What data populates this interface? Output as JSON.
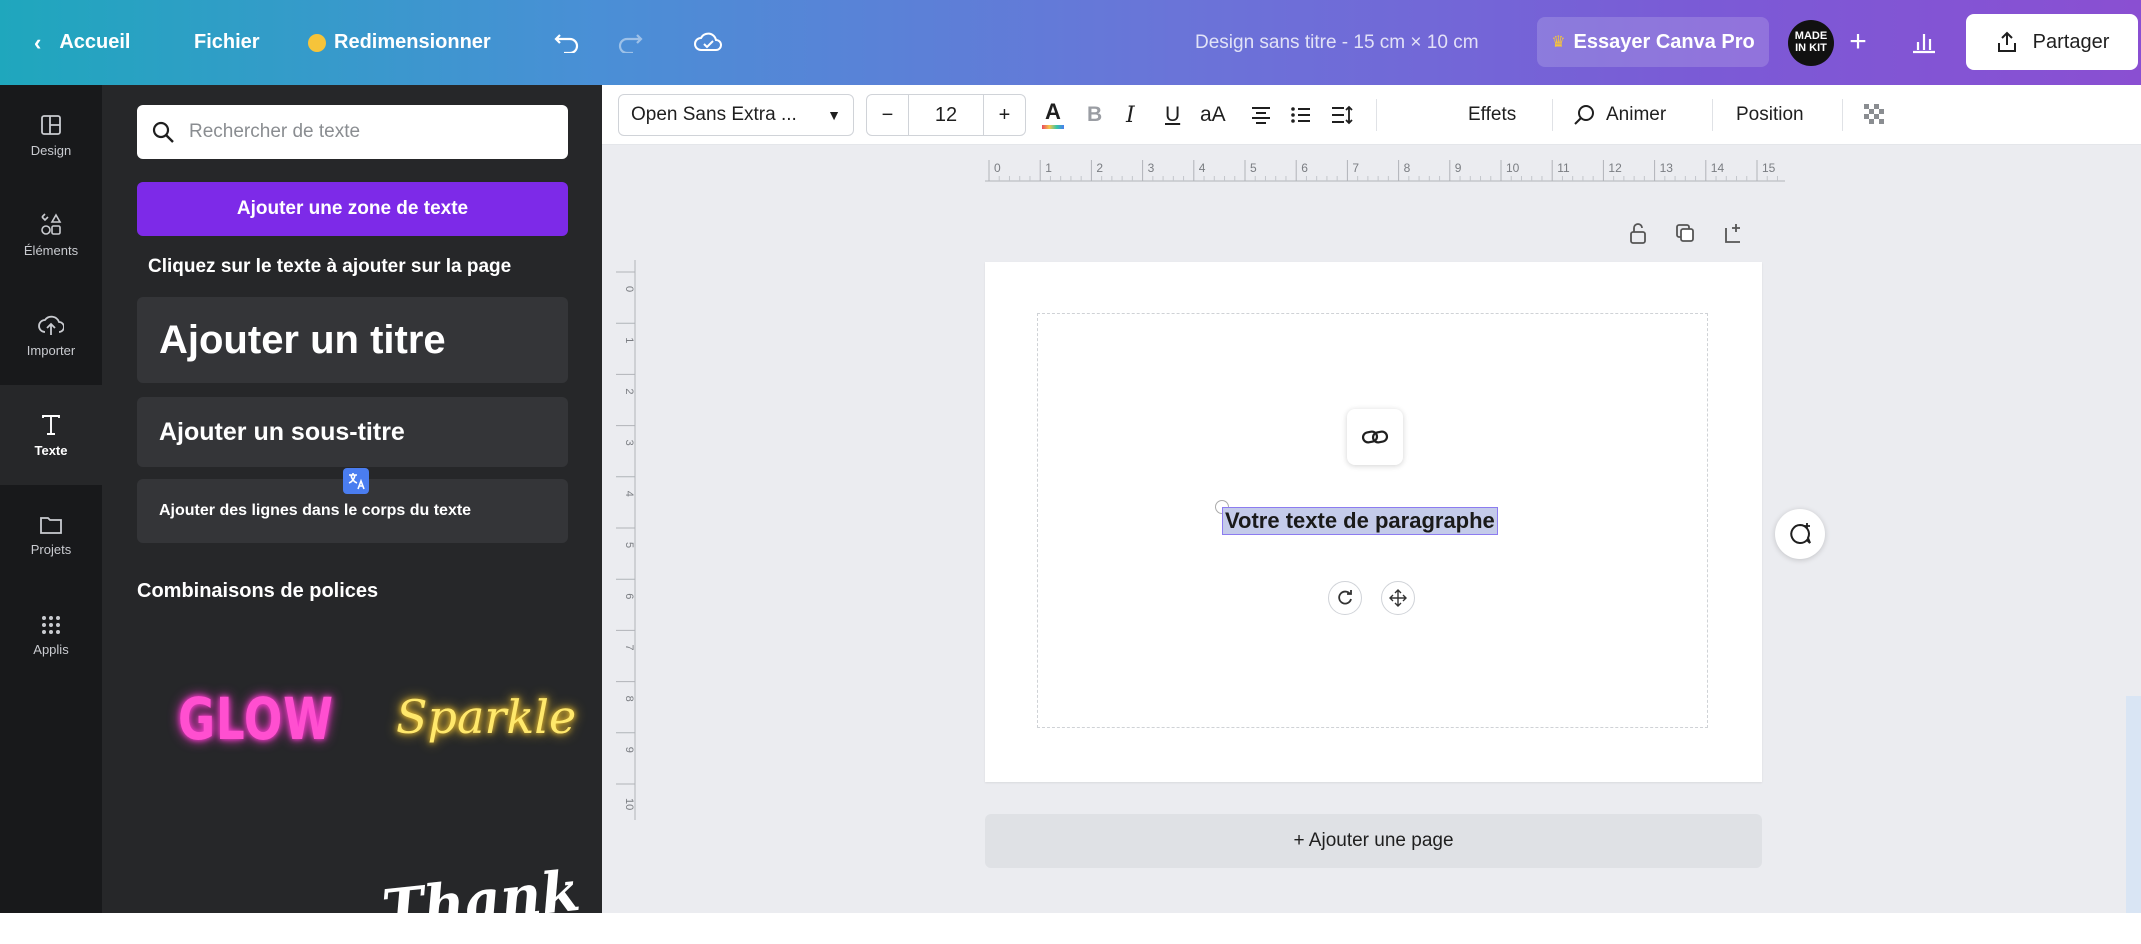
{
  "topbar": {
    "back_label": "Accueil",
    "file_label": "Fichier",
    "resize_label": "Redimensionner",
    "design_title": "Design sans titre - 15 cm × 10 cm",
    "pro_label": "Essayer Canva Pro",
    "avatar_text_1": "MADE",
    "avatar_text_2": "IN KIT",
    "share_label": "Partager"
  },
  "rail": {
    "items": [
      {
        "label": "Design",
        "icon": "layout-icon"
      },
      {
        "label": "Éléments",
        "icon": "shapes-icon"
      },
      {
        "label": "Importer",
        "icon": "cloud-upload-icon"
      },
      {
        "label": "Texte",
        "icon": "text-icon"
      },
      {
        "label": "Projets",
        "icon": "folder-icon"
      },
      {
        "label": "Applis",
        "icon": "apps-grid-icon"
      }
    ],
    "active": "Texte"
  },
  "panel": {
    "search_placeholder": "Rechercher de texte",
    "add_textbox_label": "Ajouter une zone de texte",
    "hint": "Cliquez sur le texte à ajouter sur la page",
    "title_card": "Ajouter un titre",
    "subtitle_card": "Ajouter un sous-titre",
    "body_card": "Ajouter des lignes dans le corps du texte",
    "combos_heading": "Combinaisons de polices",
    "combo_glow": "GLOW",
    "combo_sparkle": "Sparkle",
    "combo_thank": "Thank"
  },
  "toolbar": {
    "font_name": "Open Sans Extra ...",
    "minus": "−",
    "font_size": "12",
    "plus": "+",
    "text_color_glyph": "A",
    "bold": "B",
    "italic": "I",
    "underline": "U",
    "case": "aA",
    "effects_label": "Effets",
    "animate_label": "Animer",
    "position_label": "Position",
    "text_color_underline": "#e84a5f"
  },
  "ruler": {
    "top_ticks": [
      "0",
      "1",
      "2",
      "3",
      "4",
      "5",
      "6",
      "7",
      "8",
      "9",
      "10",
      "11",
      "12",
      "13",
      "14",
      "15"
    ],
    "left_ticks": [
      "0",
      "1",
      "2",
      "3",
      "4",
      "5",
      "6",
      "7",
      "8",
      "9",
      "10"
    ]
  },
  "canvas": {
    "selected_text": "Votre texte de paragraphe",
    "add_page_label": "+ Ajouter une page"
  },
  "colors": {
    "accent_purple": "#7d2ae8",
    "panel_bg": "#262729",
    "rail_bg": "#18191b",
    "workspace_bg": "#ebecf0"
  }
}
